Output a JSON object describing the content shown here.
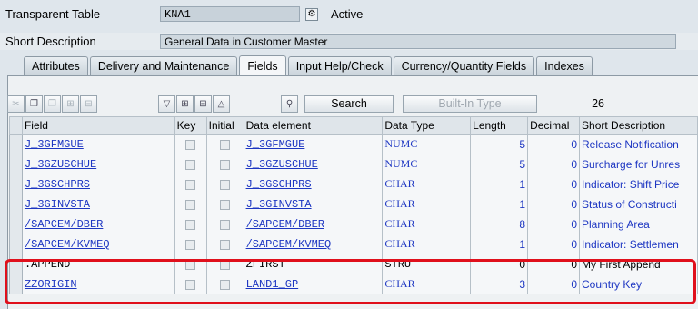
{
  "header": {
    "table_label": "Transparent Table",
    "table_value": "KNA1",
    "status": "Active",
    "short_desc_label": "Short Description",
    "short_desc_value": "General Data in Customer Master"
  },
  "tabs": [
    {
      "label": "Attributes"
    },
    {
      "label": "Delivery and Maintenance"
    },
    {
      "label": "Fields"
    },
    {
      "label": "Input Help/Check"
    },
    {
      "label": "Currency/Quantity Fields"
    },
    {
      "label": "Indexes"
    }
  ],
  "toolbar": {
    "search_label": "Search",
    "builtin_label": "Built-In Type",
    "count": "26"
  },
  "columns": [
    "Field",
    "Key",
    "Initial",
    "Data element",
    "Data Type",
    "Length",
    "Decimal",
    "Short Description"
  ],
  "rows": [
    {
      "field": "J_3GFMGUE",
      "data_element": "J_3GFMGUE",
      "data_type": "NUMC",
      "length": "5",
      "decimal": "0",
      "desc": "Release Notification"
    },
    {
      "field": "J_3GZUSCHUE",
      "data_element": "J_3GZUSCHUE",
      "data_type": "NUMC",
      "length": "5",
      "decimal": "0",
      "desc": "Surcharge for Unres"
    },
    {
      "field": "J_3GSCHPRS",
      "data_element": "J_3GSCHPRS",
      "data_type": "CHAR",
      "length": "1",
      "decimal": "0",
      "desc": "Indicator: Shift Price"
    },
    {
      "field": "J_3GINVSTA",
      "data_element": "J_3GINVSTA",
      "data_type": "CHAR",
      "length": "1",
      "decimal": "0",
      "desc": "Status of Constructi"
    },
    {
      "field": "/SAPCEM/DBER",
      "data_element": "/SAPCEM/DBER",
      "data_type": "CHAR",
      "length": "8",
      "decimal": "0",
      "desc": "Planning Area"
    },
    {
      "field": "/SAPCEM/KVMEQ",
      "data_element": "/SAPCEM/KVMEQ",
      "data_type": "CHAR",
      "length": "1",
      "decimal": "0",
      "desc": "Indicator: Settlemen"
    },
    {
      "field": ".APPEND",
      "data_element": "ZFIRST",
      "data_type": "STRU",
      "length": "0",
      "decimal": "0",
      "desc": "My First Append"
    },
    {
      "field": "ZZORIGIN",
      "data_element": "LAND1_GP",
      "data_type": "CHAR",
      "length": "3",
      "decimal": "0",
      "desc": "Country Key"
    }
  ]
}
